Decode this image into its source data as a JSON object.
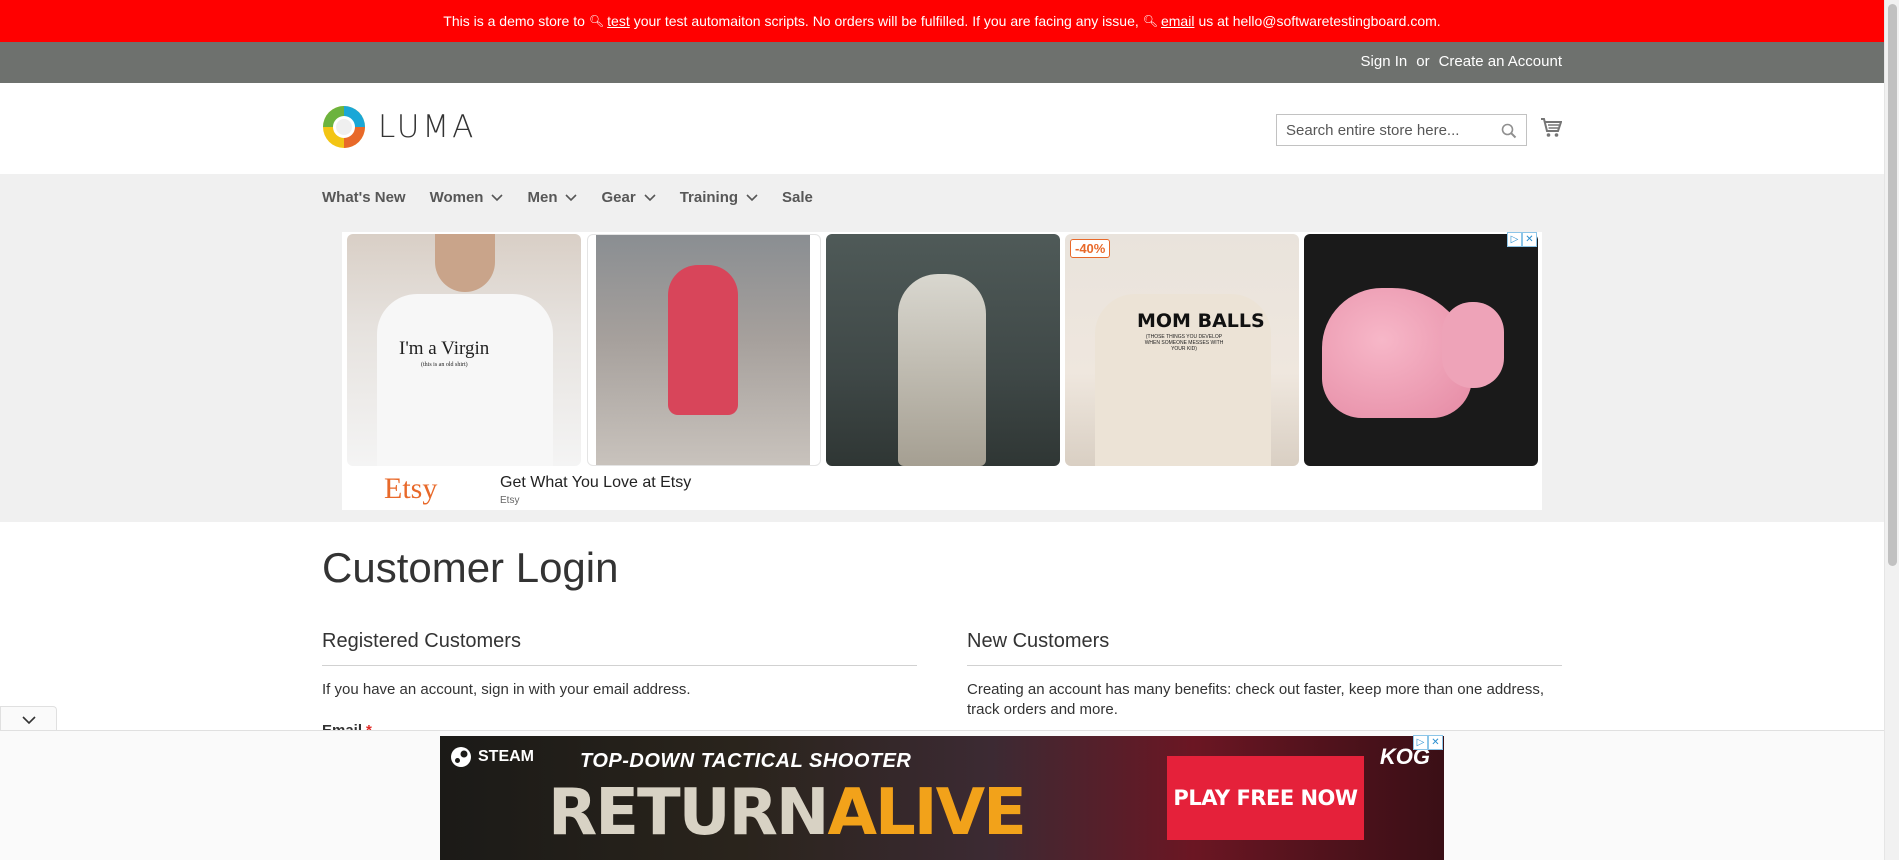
{
  "demo_banner": {
    "part1": "This is a demo store to",
    "link1": "test",
    "part2": "your test automaiton scripts. No orders will be fulfilled. If you are facing any issue,",
    "link2": "email",
    "part3": "us at hello@softwaretestingboard.com."
  },
  "top_bar": {
    "sign_in": "Sign In",
    "or": "or",
    "create_account": "Create an Account"
  },
  "header": {
    "logo_text": "LUMA",
    "search_placeholder": "Search entire store here..."
  },
  "nav": {
    "items": [
      {
        "label": "What's New",
        "has_submenu": false
      },
      {
        "label": "Women",
        "has_submenu": true
      },
      {
        "label": "Men",
        "has_submenu": true
      },
      {
        "label": "Gear",
        "has_submenu": true
      },
      {
        "label": "Training",
        "has_submenu": true
      },
      {
        "label": "Sale",
        "has_submenu": false
      }
    ]
  },
  "ad": {
    "tile1_text": "I'm a Virgin",
    "tile1_subtext": "(this is an old shirt)",
    "tile4_badge": "-40%",
    "tile4_text": "MOM BALLS",
    "tile4_subtext": "(THOSE THINGS YOU DEVELOP WHEN SOMEONE MESSES WITH YOUR KID)",
    "brand": "Etsy",
    "headline": "Get What You Love at Etsy",
    "source": "Etsy"
  },
  "main": {
    "page_title": "Customer Login",
    "registered": {
      "heading": "Registered Customers",
      "text": "If you have an account, sign in with your email address.",
      "email_label": "Email",
      "required_mark": "*"
    },
    "new_customers": {
      "heading": "New Customers",
      "text": "Creating an account has many benefits: check out faster, keep more than one address, track orders and more."
    }
  },
  "bottom_ad": {
    "platform": "STEAM",
    "tagline": "TOP-DOWN TACTICAL SHOOTER",
    "title_part1": "RETURN",
    "title_part2": "ALIVE",
    "cta": "PLAY FREE NOW",
    "publisher": "KOG"
  },
  "colors": {
    "banner_red": "#ff0000",
    "top_bar_gray": "#6e716e",
    "nav_bg": "#f0f0f0",
    "etsy_orange": "#e8692a",
    "required_red": "#e02b27"
  }
}
